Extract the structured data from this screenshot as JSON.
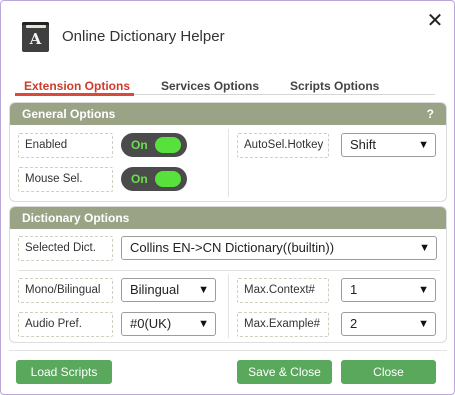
{
  "app": {
    "title": "Online Dictionary Helper",
    "icon_name": "dictionary-book-icon",
    "icon_glyph": "A",
    "close_glyph": "✕"
  },
  "tabs": [
    {
      "label": "Extension Options",
      "active": true
    },
    {
      "label": "Services Options",
      "active": false
    },
    {
      "label": "Scripts Options",
      "active": false
    }
  ],
  "general": {
    "title": "General Options",
    "help": "?",
    "enabled_label": "Enabled",
    "enabled_toggle": "On",
    "mousesel_label": "Mouse Sel.",
    "mousesel_toggle": "On",
    "hotkey_label": "AutoSel.Hotkey",
    "hotkey_value": "Shift"
  },
  "dictionary": {
    "title": "Dictionary Options",
    "selected_label": "Selected Dict.",
    "selected_value": "Collins EN->CN Dictionary((builtin))",
    "mono_label": "Mono/Bilingual",
    "mono_value": "Bilingual",
    "audio_label": "Audio Pref.",
    "audio_value": "#0(UK)",
    "maxcontext_label": "Max.Context#",
    "maxcontext_value": "1",
    "maxexample_label": "Max.Example#",
    "maxexample_value": "2"
  },
  "footer": {
    "load_scripts": "Load Scripts",
    "save_close": "Save & Close",
    "close": "Close"
  },
  "colors": {
    "accent_tab": "#cf3b2c",
    "panel_header": "#9aa386",
    "toggle_on": "#58e03d",
    "button": "#5aa85b"
  }
}
